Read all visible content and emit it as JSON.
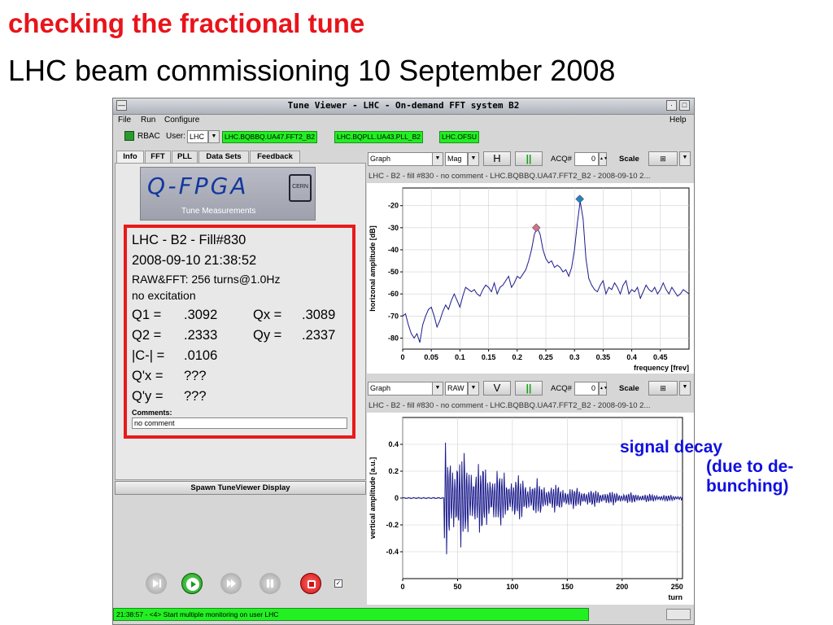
{
  "slide": {
    "title": "checking the fractional tune",
    "subtitle": "LHC beam commissioning 10 September 2008",
    "annotation_line1": "signal decay",
    "annotation_line2": "(due to de-",
    "annotation_line3": "bunching)"
  },
  "window": {
    "title": "Tune Viewer - LHC - On-demand FFT system B2",
    "menu": [
      "File",
      "Run",
      "Configure"
    ],
    "help": "Help"
  },
  "toolbar": {
    "rbac": "RBAC",
    "user_label": "User:",
    "user_value": "LHC",
    "badges": [
      "LHC.BQBBQ.UA47.FFT2_B2",
      "LHC.BQPLL.UA43.PLL_B2",
      "LHC.OFSU"
    ]
  },
  "tabs": [
    "Info",
    "FFT",
    "PLL",
    "Data Sets",
    "Feedback"
  ],
  "logo": {
    "text": "Q-FPGA",
    "subtitle": "Tune Measurements",
    "cern": "CERN"
  },
  "info": {
    "line1": "LHC - B2 - Fill#830",
    "line2": "2008-09-10 21:38:52",
    "line3": "RAW&FFT: 256 turns@1.0Hz",
    "line4": "no excitation",
    "q1_label": "Q1 =",
    "q1_value": ".3092",
    "qx_label": "Qx =",
    "qx_value": ".3089",
    "q2_label": "Q2 =",
    "q2_value": ".2333",
    "qy_label": "Qy =",
    "qy_value": ".2337",
    "c_label": "|C-| =",
    "c_value": ".0106",
    "qpx_label": "Q'x =",
    "qpx_value": "???",
    "qpy_label": "Q'y =",
    "qpy_value": "???",
    "comments_label": "Comments:",
    "comments_value": "no comment"
  },
  "spawn_button": "Spawn TuneViewer Display",
  "status_message": "21:38:57 - <4> Start multiple monitoring on user LHC",
  "top_controls": {
    "view": "Graph",
    "mode": "Mag",
    "plane": "H",
    "pause": "||",
    "acq_label": "ACQ#",
    "acq_value": "0",
    "scale": "Scale"
  },
  "bottom_controls": {
    "view": "Graph",
    "mode": "RAW",
    "plane": "V",
    "pause": "||",
    "acq_label": "ACQ#",
    "acq_value": "0",
    "scale": "Scale"
  },
  "top_chart_header": "LHC - B2 - fill #830 - no comment - LHC.BQBBQ.UA47.FFT2_B2 - 2008-09-10 2...",
  "bottom_chart_header": "LHC - B2 - fill #830 - no comment - LHC.BQBBQ.UA47.FFT2_B2 - 2008-09-10 2...",
  "colors": {
    "accent_red": "#e8141b",
    "trace": "#1a1a8c",
    "status_green": "#22f022",
    "annotation": "#1010e0"
  },
  "chart_data": [
    {
      "type": "line",
      "title": "",
      "xlabel": "frequency [frev]",
      "ylabel": "horizonal amplitude [dB]",
      "xlim": [
        0,
        0.5
      ],
      "ylim": [
        -85,
        -12
      ],
      "xticks": [
        0,
        0.05,
        0.1,
        0.15,
        0.2,
        0.25,
        0.3,
        0.35,
        0.4,
        0.45
      ],
      "xtick_labels": [
        "0",
        "0.05",
        "0.1",
        "0.15",
        "0.2",
        "0.25",
        "0.3",
        "0.35",
        "0.4",
        "0.45"
      ],
      "yticks": [
        -20,
        -30,
        -40,
        -50,
        -60,
        -70,
        -80
      ],
      "ytick_labels": [
        "-20",
        "-30",
        "-40",
        "-50",
        "-60",
        "-70",
        "-80"
      ],
      "grid": true,
      "series": [
        {
          "x": [
            0.0,
            0.005,
            0.01,
            0.015,
            0.02,
            0.025,
            0.03,
            0.035,
            0.04,
            0.045,
            0.05,
            0.055,
            0.06,
            0.065,
            0.07,
            0.075,
            0.08,
            0.085,
            0.09,
            0.095,
            0.1,
            0.105,
            0.11,
            0.115,
            0.12,
            0.125,
            0.13,
            0.135,
            0.14,
            0.145,
            0.15,
            0.155,
            0.16,
            0.165,
            0.17,
            0.175,
            0.18,
            0.185,
            0.19,
            0.195,
            0.2,
            0.205,
            0.21,
            0.215,
            0.22,
            0.225,
            0.23,
            0.235,
            0.24,
            0.245,
            0.25,
            0.255,
            0.26,
            0.265,
            0.27,
            0.275,
            0.28,
            0.285,
            0.29,
            0.295,
            0.3,
            0.305,
            0.31,
            0.315,
            0.32,
            0.325,
            0.33,
            0.335,
            0.34,
            0.345,
            0.35,
            0.355,
            0.36,
            0.365,
            0.37,
            0.375,
            0.38,
            0.385,
            0.39,
            0.395,
            0.4,
            0.405,
            0.41,
            0.415,
            0.42,
            0.425,
            0.43,
            0.435,
            0.44,
            0.445,
            0.45,
            0.455,
            0.46,
            0.465,
            0.47,
            0.475,
            0.48,
            0.485,
            0.49,
            0.495,
            0.5
          ],
          "y": [
            -70,
            -69,
            -74,
            -78,
            -80,
            -78,
            -82,
            -74,
            -70,
            -67,
            -66,
            -70,
            -75,
            -72,
            -68,
            -65,
            -67,
            -63,
            -60,
            -63,
            -66,
            -61,
            -57,
            -58,
            -59,
            -58,
            -60,
            -61,
            -58,
            -56,
            -57,
            -59,
            -55,
            -60,
            -57,
            -56,
            -54,
            -52,
            -57,
            -55,
            -52,
            -53,
            -51,
            -49,
            -45,
            -40,
            -33,
            -30,
            -33,
            -40,
            -44,
            -46,
            -45,
            -48,
            -47,
            -48,
            -50,
            -49,
            -52,
            -48,
            -40,
            -28,
            -18,
            -26,
            -44,
            -53,
            -56,
            -58,
            -59,
            -56,
            -54,
            -60,
            -57,
            -58,
            -55,
            -57,
            -60,
            -56,
            -54,
            -60,
            -58,
            -59,
            -57,
            -62,
            -59,
            -56,
            -58,
            -59,
            -57,
            -60,
            -58,
            -55,
            -58,
            -60,
            -57,
            -59,
            -61,
            -60,
            -58,
            -59,
            -60
          ]
        }
      ],
      "markers": [
        {
          "x": 0.2333,
          "y": -30,
          "color": "#c8748a"
        },
        {
          "x": 0.3092,
          "y": -17,
          "color": "#2a7fc0"
        }
      ]
    },
    {
      "type": "line",
      "title": "",
      "xlabel": "turn",
      "ylabel": "vertical amplitude [a.u.]",
      "xlim": [
        0,
        255
      ],
      "ylim": [
        -0.6,
        0.6
      ],
      "xticks": [
        0,
        50,
        100,
        150,
        200,
        250
      ],
      "xtick_labels": [
        "0",
        "50",
        "100",
        "150",
        "200",
        "250"
      ],
      "yticks": [
        0.4,
        0.2,
        0,
        -0.2,
        -0.4
      ],
      "ytick_labels": [
        "0.4",
        "0.2",
        "0",
        "-0.2",
        "-0.4"
      ],
      "grid": true,
      "decay": {
        "baseline_noise": 0.005,
        "onset_turn": 38,
        "peak_amplitude": 0.5,
        "decay_tau_turns": 70,
        "fractional_tune": 0.2337
      }
    }
  ]
}
